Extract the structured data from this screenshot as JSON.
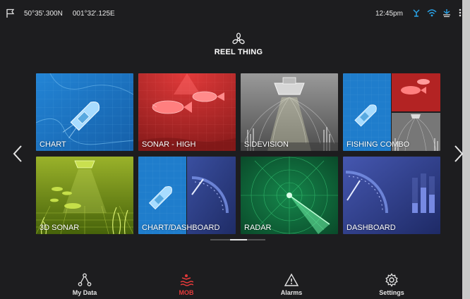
{
  "status_bar": {
    "latitude": "50°35'.300N",
    "longitude": "001°32'.125E",
    "time": "12:45pm"
  },
  "header": {
    "boat_name": "REEL THING"
  },
  "apps": [
    {
      "label": "CHART"
    },
    {
      "label": "SONAR - HIGH"
    },
    {
      "label": "SIDEVISION"
    },
    {
      "label": "FISHING COMBO"
    },
    {
      "label": "3D SONAR"
    },
    {
      "label": "CHART/DASHBOARD"
    },
    {
      "label": "RADAR"
    },
    {
      "label": "DASHBOARD"
    }
  ],
  "pager": {
    "pages": 3,
    "current": 2
  },
  "bottom_bar": {
    "my_data": "My Data",
    "mob": "MOB",
    "alarms": "Alarms",
    "settings": "Settings"
  },
  "colors": {
    "accent_blue": "#1a74c9",
    "sonar_red": "#c62b2b",
    "mob_red": "#e43a3a",
    "radar_green": "#0e6b3c",
    "sonar3d_green": "#6f8f18"
  },
  "icons": {
    "status": [
      "flag-icon",
      "fish-finder-icon",
      "wifi-icon",
      "sonar-link-icon",
      "menu-icon"
    ],
    "bottom": [
      "waypoints-icon",
      "mob-icon",
      "alarm-icon",
      "gear-icon"
    ]
  }
}
